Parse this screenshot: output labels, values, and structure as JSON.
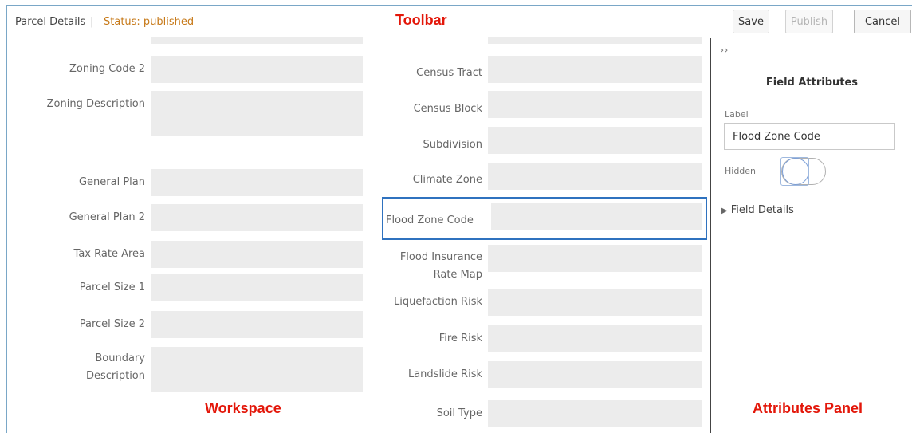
{
  "toolbar": {
    "title": "Parcel Details",
    "separator": "|",
    "status": "Status: published",
    "save_label": "Save",
    "publish_label": "Publish",
    "cancel_label": "Cancel"
  },
  "annotations": {
    "toolbar": "Toolbar",
    "workspace": "Workspace",
    "attributes_panel": "Attributes Panel"
  },
  "workspace": {
    "left_fields": [
      {
        "label": "Zoning Code 2"
      },
      {
        "label": "Zoning Description"
      },
      {
        "label": "General Plan"
      },
      {
        "label": "General Plan 2"
      },
      {
        "label": "Tax Rate Area"
      },
      {
        "label": "Parcel Size 1"
      },
      {
        "label": "Parcel Size 2"
      },
      {
        "label": "Boundary Description"
      }
    ],
    "right_fields": [
      {
        "label": "Census Tract"
      },
      {
        "label": "Census Block"
      },
      {
        "label": "Subdivision"
      },
      {
        "label": "Climate Zone"
      },
      {
        "label": "Flood Zone Code",
        "selected": true
      },
      {
        "label": "Flood Insurance Rate Map"
      },
      {
        "label": "Liquefaction Risk"
      },
      {
        "label": "Fire Risk"
      },
      {
        "label": "Landslide Risk"
      },
      {
        "label": "Soil Type"
      }
    ]
  },
  "panel": {
    "collapse_glyph": "››",
    "heading": "Field Attributes",
    "label_caption": "Label",
    "label_value": "Flood Zone Code",
    "hidden_caption": "Hidden",
    "hidden_on": false,
    "details_label": "Field Details",
    "details_icon": "triangle-right-icon"
  },
  "colors": {
    "status": "#c77a1a",
    "annotation": "#e3170a",
    "selection": "#2f72bf",
    "field_fill": "#ececec"
  }
}
